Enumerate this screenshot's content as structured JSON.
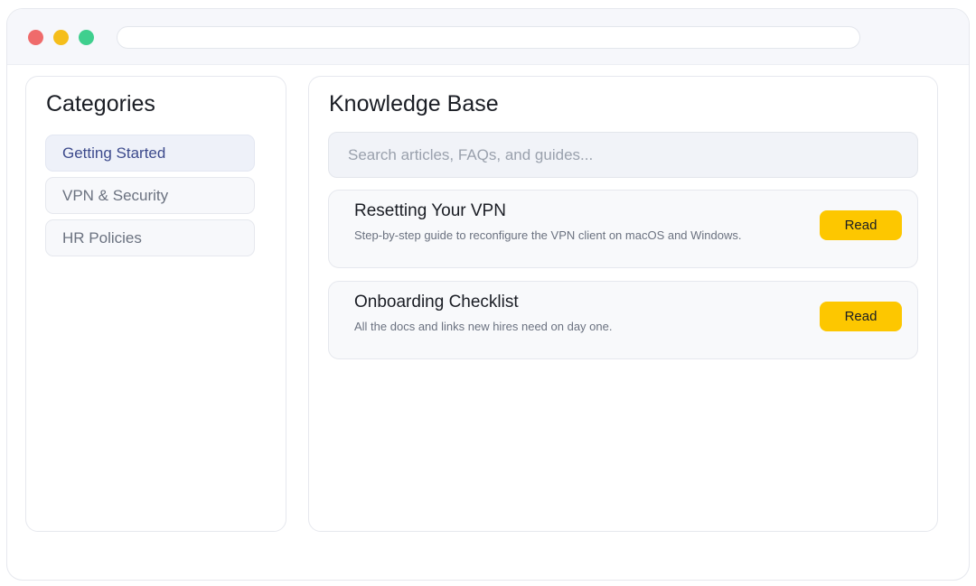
{
  "sidebar": {
    "title": "Categories",
    "items": [
      {
        "label": "Getting Started",
        "active": true
      },
      {
        "label": "VPN & Security",
        "active": false
      },
      {
        "label": "HR Policies",
        "active": false
      }
    ]
  },
  "main": {
    "title": "Knowledge Base",
    "search_placeholder": "Search articles, FAQs, and guides...",
    "articles": [
      {
        "title": "Resetting Your VPN",
        "description": "Step-by-step guide to reconfigure the VPN client on macOS and Windows.",
        "action_label": "Read"
      },
      {
        "title": "Onboarding Checklist",
        "description": "All the docs and links new hires need on day one.",
        "action_label": "Read"
      }
    ]
  },
  "colors": {
    "accent": "#fdc700",
    "active_item_bg": "#eef1f9",
    "active_item_text": "#3c4a8c",
    "window_close": "#ef6b6b",
    "window_minimize": "#f5be1b",
    "window_maximize": "#3fcf8e"
  }
}
